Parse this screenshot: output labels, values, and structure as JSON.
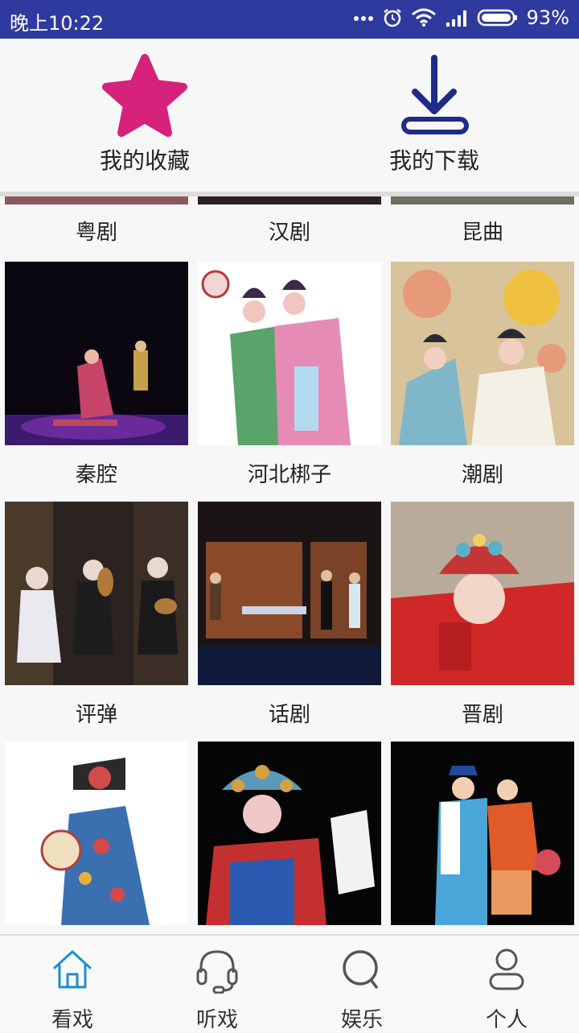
{
  "status_bar": {
    "time": "晚上10:22",
    "battery_percent": "93%",
    "icons": [
      "more-dots-icon",
      "alarm-icon",
      "wifi-icon",
      "signal-icon",
      "battery-icon"
    ]
  },
  "top_actions": [
    {
      "label": "我的收藏",
      "icon": "star-icon",
      "color": "#d6227a"
    },
    {
      "label": "我的下载",
      "icon": "download-icon",
      "color": "#1f2a8a"
    }
  ],
  "opera_grid": {
    "partial_row": [
      "粤剧",
      "汉剧",
      "昆曲"
    ],
    "rows": [
      [
        "秦腔",
        "河北梆子",
        "潮剧"
      ],
      [
        "评弹",
        "话剧",
        "晋剧"
      ],
      [
        "",
        "",
        ""
      ]
    ]
  },
  "bottom_nav": {
    "items": [
      {
        "label": "看戏",
        "icon": "home-icon",
        "active": true
      },
      {
        "label": "听戏",
        "icon": "headphones-icon",
        "active": false
      },
      {
        "label": "娱乐",
        "icon": "search-icon",
        "active": false
      },
      {
        "label": "个人",
        "icon": "person-icon",
        "active": false
      }
    ],
    "active_color": "#1a8fd1"
  }
}
